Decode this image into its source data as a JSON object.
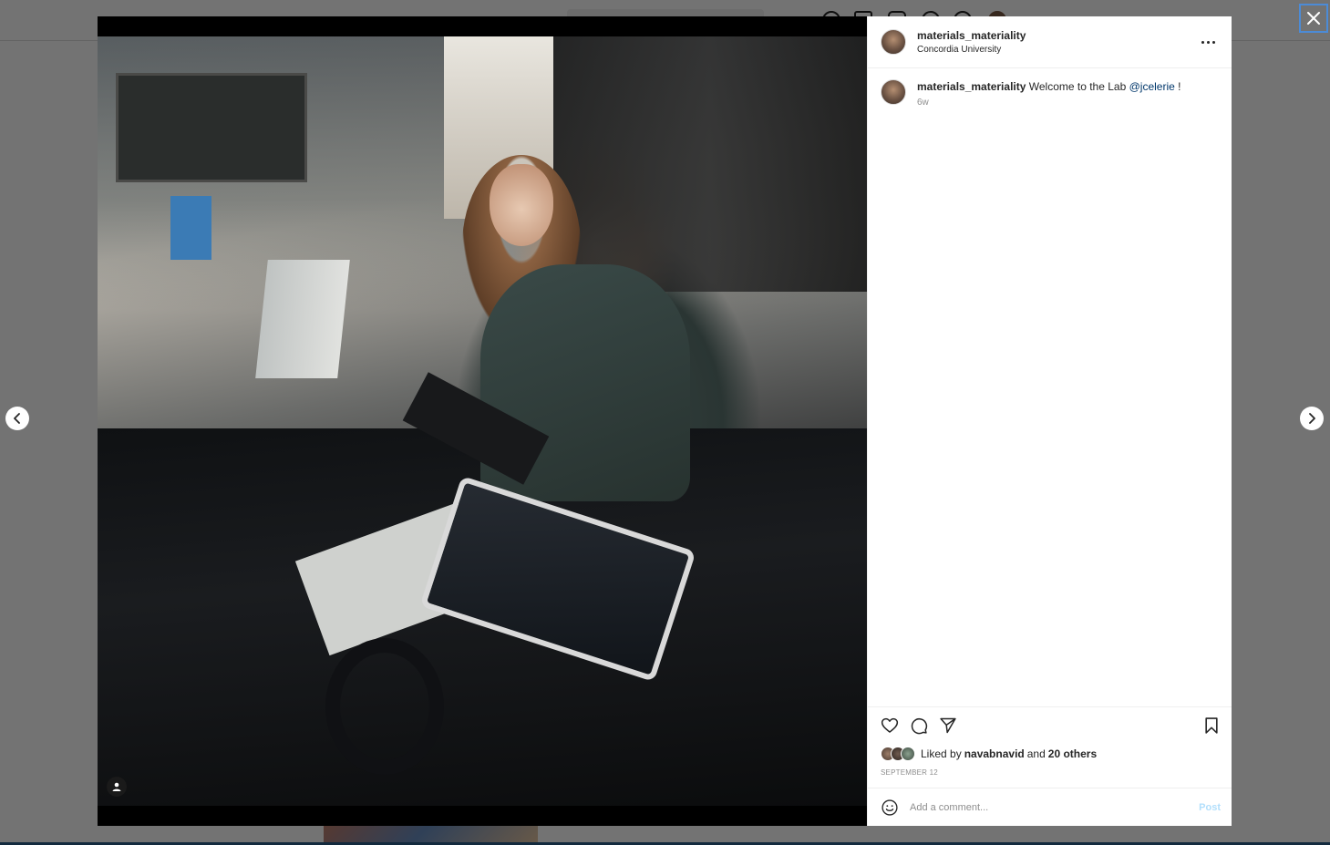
{
  "post": {
    "author": {
      "username": "materials_materiality",
      "location": "Concordia University"
    },
    "caption": {
      "username": "materials_materiality",
      "text_before": "Welcome to the Lab ",
      "mention": "@jcelerie",
      "text_after": " !",
      "time_ago": "6w"
    },
    "likes": {
      "prefix": "Liked by",
      "liker": "navabnavid",
      "conjunction": "and",
      "others": "20 others"
    },
    "date": "SEPTEMBER 12"
  },
  "comment_box": {
    "placeholder": "Add a comment...",
    "post_label": "Post"
  },
  "icons": {
    "like": "heart-icon",
    "comment": "comment-icon",
    "share": "paper-plane-icon",
    "save": "bookmark-icon",
    "more": "more-options-icon",
    "emoji": "emoji-icon",
    "tag": "user-tag-icon",
    "close": "close-icon",
    "prev": "chevron-left-icon",
    "next": "chevron-right-icon"
  },
  "colors": {
    "link": "#00376b",
    "post_button_disabled": "#b2dffc",
    "muted_text": "#8e8e8e",
    "text": "#262626"
  }
}
